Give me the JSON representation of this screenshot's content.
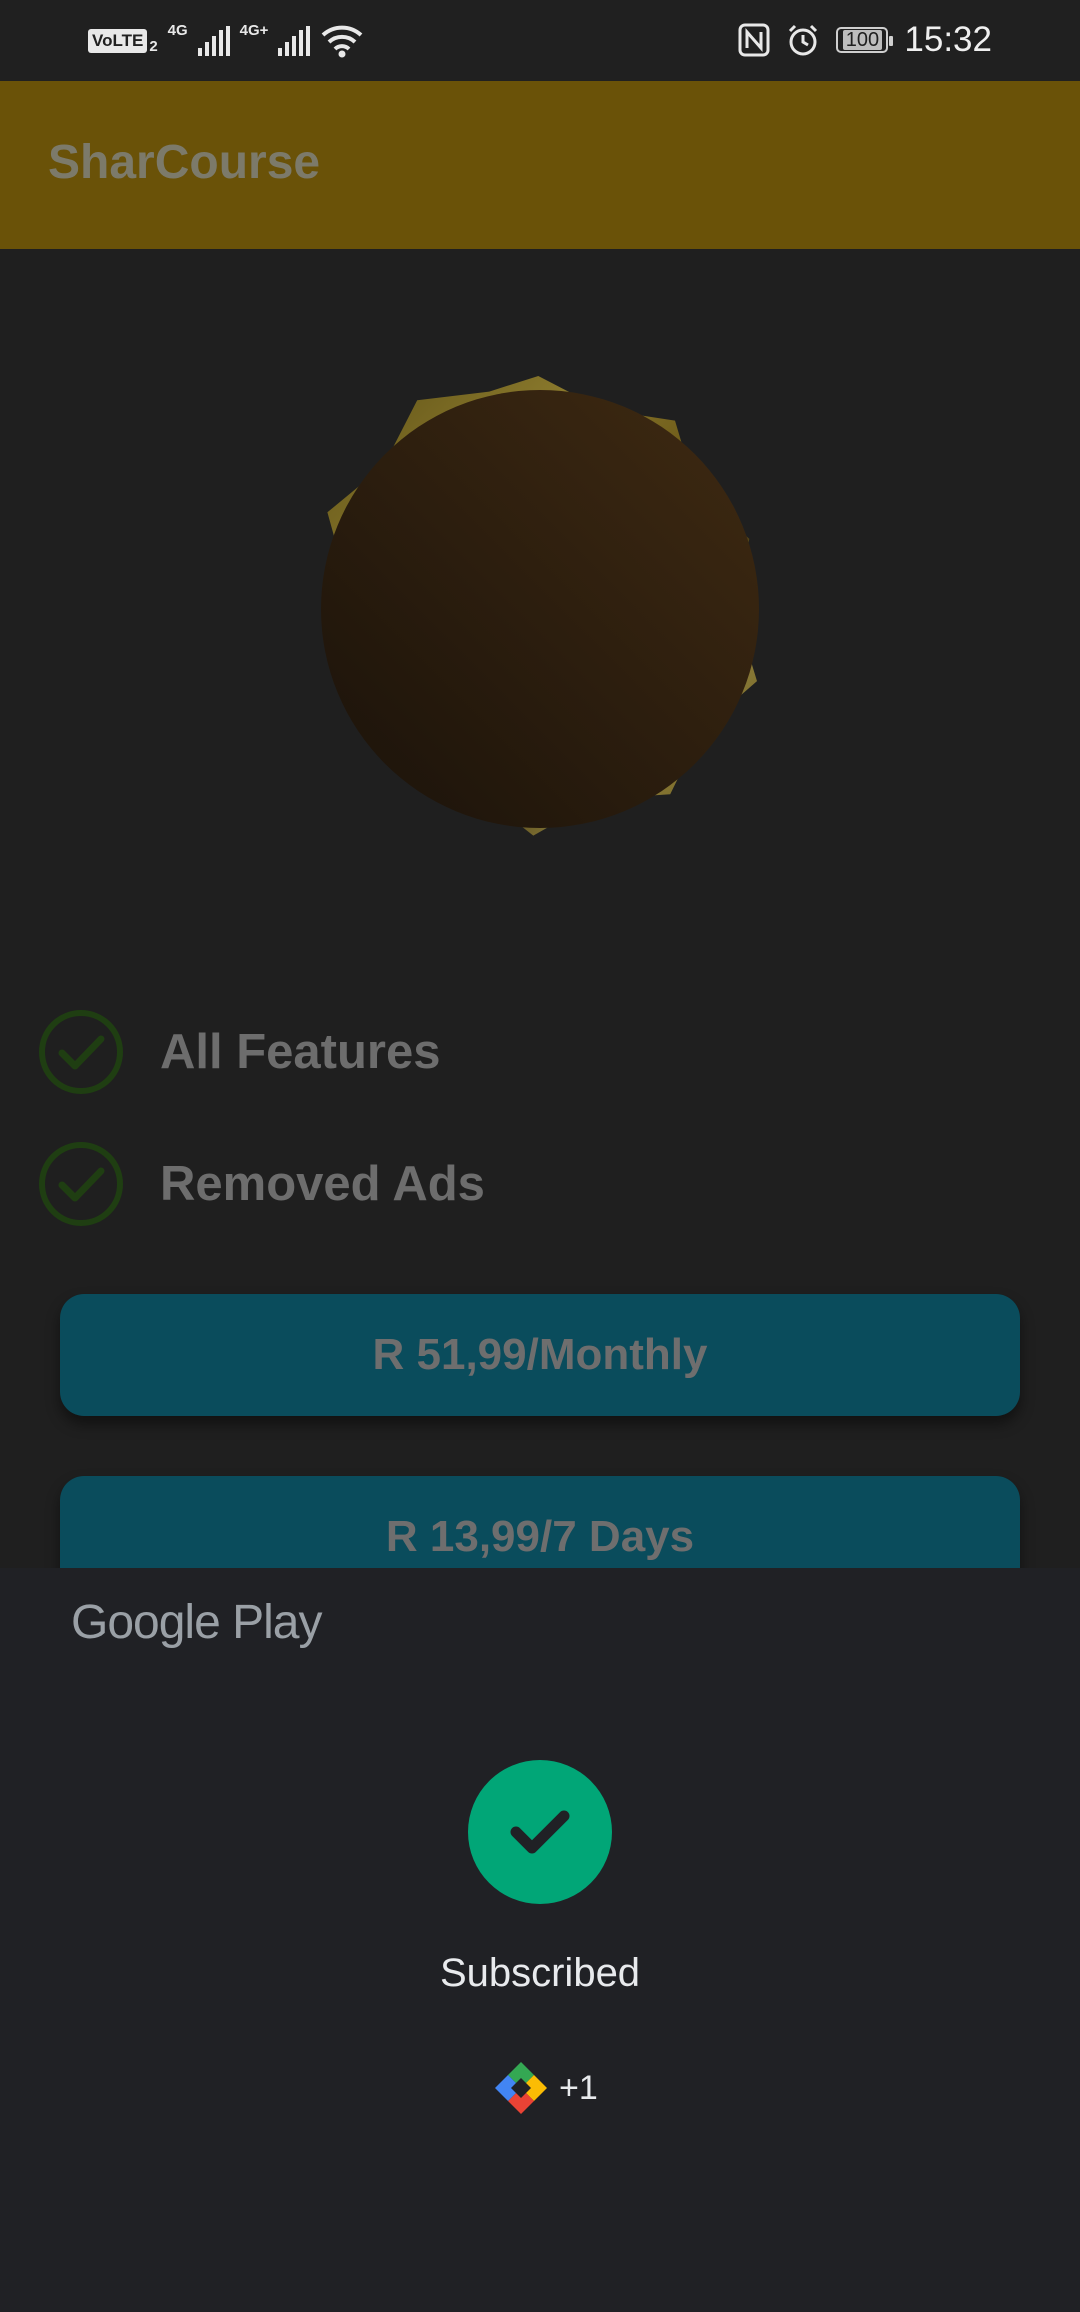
{
  "status_bar": {
    "volte": "VoLTE",
    "sim_index": "2",
    "network_1": "4G",
    "network_2": "4G+",
    "battery": "100",
    "time": "15:32",
    "icons": [
      "signal-icon",
      "signal-icon",
      "wifi-icon",
      "nfc-icon",
      "alarm-icon",
      "battery-icon"
    ]
  },
  "app_bar": {
    "title": "SharCourse",
    "color": "#6a5208"
  },
  "features": [
    {
      "label": "All Features",
      "icon": "check-circle-icon"
    },
    {
      "label": "Removed Ads",
      "icon": "check-circle-icon"
    }
  ],
  "plans": [
    {
      "label": "R 51,99/Monthly"
    },
    {
      "label": "R 13,99/7 Days"
    }
  ],
  "play_sheet": {
    "brand": "Google Play",
    "status": "Subscribed",
    "extra_icon": "google-play-points-icon",
    "extra_count": "+1",
    "success_color": "#01a677"
  }
}
